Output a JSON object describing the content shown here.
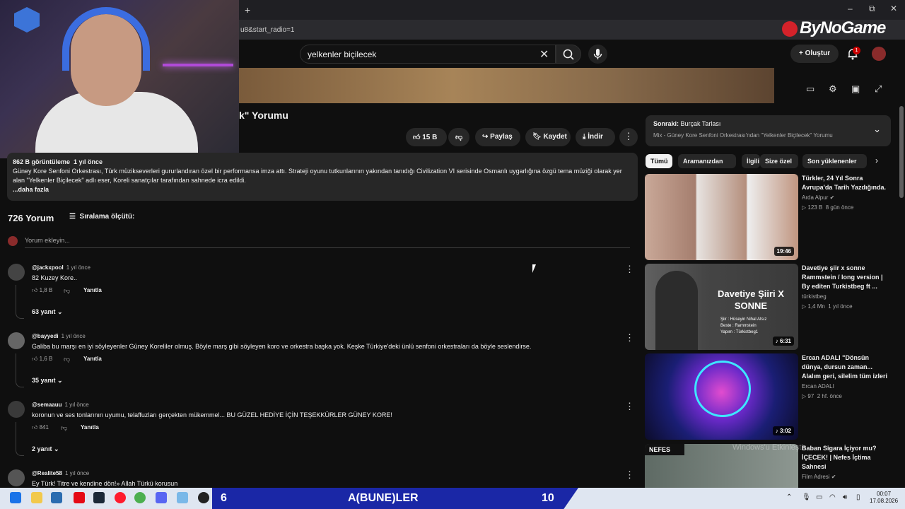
{
  "browser": {
    "new_tab": "+",
    "url_fragment": "u8&start_radio=1",
    "window_controls": [
      "–",
      "⧉",
      "✕"
    ]
  },
  "header": {
    "search_query": "yelkenler biçilecek",
    "create_label": "Oluştur",
    "notification_count": "1"
  },
  "overlay": {
    "sponsor": "ByNoGame"
  },
  "video": {
    "title_fragment": "k\" Yorumu",
    "like_count": "15 B",
    "share_label": "Paylaş",
    "save_label": "Kaydet",
    "download_label": "İndir",
    "more_icon": "⋮"
  },
  "description": {
    "views": "862 B görüntüleme",
    "age": "1 yıl önce",
    "text": "Güney Kore Senfoni Orkestrası, Türk müzikseverleri gururlandıran özel bir performansa imza attı. Strateji oyunu tutkunlarının yakından tanıdığı Civilization VI serisinde Osmanlı uygarlığına özgü tema müziği olarak yer alan \"Yelkenler Biçilecek\" adlı eser, Koreli sanatçılar tarafından sahnede icra edildi.",
    "more": "...daha fazla"
  },
  "comments": {
    "count_label": "726 Yorum",
    "sort_label": "Sıralama ölçütü:",
    "add_placeholder": "Yorum ekleyin...",
    "reply_label": "Yanıtla",
    "items": [
      {
        "author": "@jackxpool",
        "time": "1 yıl önce",
        "text": "82 Kuzey Kore..",
        "likes": "1,8 B",
        "replies": "63 yanıt"
      },
      {
        "author": "@bayyedi",
        "time": "1 yıl önce",
        "text": "Galiba bu marşı en iyi söyleyenler Güney Koreliler olmuş. Böyle marş gibi söyleyen koro ve orkestra başka yok. Keşke Türkiye'deki ünlü senfoni orkestraları da böyle seslendirse.",
        "likes": "1,6 B",
        "replies": "35 yanıt"
      },
      {
        "author": "@semaauu",
        "time": "1 yıl önce",
        "text": "koronun ve ses tonlarının uyumu, telaffuzları gerçekten mükemmel... BU GÜZEL HEDİYE İÇİN TEŞEKKÜRLER GÜNEY KORE!",
        "likes": "841",
        "replies": "2 yanıt"
      },
      {
        "author": "@Realite58",
        "time": "1 yıl önce",
        "text": "Ey Türk! Titre ve kendine dön!» Allah Türkü korusun",
        "likes": "",
        "replies": ""
      }
    ]
  },
  "up_next": {
    "label": "Sonraki:",
    "title": "Burçak Tarlası",
    "subtitle": "Mix - Güney Kore Senfoni Orkestrası'ndan \"Yelkenler Biçilecek\" Yorumu"
  },
  "chips": [
    "Tümü",
    "Aramanızdan",
    "İlgili",
    "Size özel",
    "Son yüklenenler"
  ],
  "recommendations": [
    {
      "title": "Türkler, 24 Yıl Sonra Avrupa'da Tarih Yazdığında.",
      "channel": "Arda Alpur ✔",
      "views": "▷ 123 B",
      "age": "8 gün önce",
      "duration": "19:46"
    },
    {
      "title": "Davetiye şiir x sonne Rammstein / long version | By editen Turkistbeg ft ...",
      "channel": "türkistbeg",
      "views": "▷ 1,4 Mn",
      "age": "1 yıl önce",
      "duration": "♪ 6:31",
      "thumb_title": "Davetiye Şiiri X SONNE",
      "thumb_sub": "Şiir : Hüseyin Nihal Atsız\nBeste : Rammstein\nYapım : Türkistbeg1"
    },
    {
      "title": "Ercan ADALI \"Dönsün dünya, dursun zaman... Alalım geri, silelim tüm izleri",
      "channel": "Ercan ADALI",
      "views": "▷ 97",
      "age": "2 hf. önce",
      "duration": "♪ 3:02"
    },
    {
      "title": "Baban Sigara İçiyor mu? İÇECEK! | Nefes İçtima Sahnesi",
      "channel": "Film Adresi ✔",
      "views": "",
      "age": "",
      "duration": "",
      "thumb_label": "NEFES"
    }
  ],
  "watermark": "Windows'u Etkinleştir",
  "taskbar": {
    "left_number": "6",
    "banner_text": "A(BUNE)LER",
    "right_number": "10",
    "time": "00:07",
    "date": "17.08.2026"
  }
}
